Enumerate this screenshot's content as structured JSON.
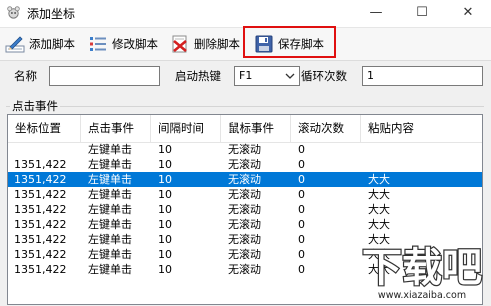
{
  "window": {
    "title": "添加坐标",
    "controls": {
      "minimize": "—",
      "maximize": "☐",
      "close": "✕"
    }
  },
  "toolbar": {
    "add_label": "添加脚本",
    "edit_label": "修改脚本",
    "delete_label": "删除脚本",
    "save_label": "保存脚本"
  },
  "form": {
    "name_label": "名称",
    "name_value": "",
    "hotkey_label": "启动热键",
    "hotkey_value": "F1",
    "loop_label": "循环次数",
    "loop_value": "1"
  },
  "events_group": {
    "title": "点击事件",
    "columns": [
      "坐标位置",
      "点击事件",
      "间隔时间",
      "鼠标事件",
      "滚动次数",
      "粘贴内容"
    ],
    "rows": [
      {
        "pos": "",
        "click": "左键单击",
        "interval": "10",
        "mouse": "无滚动",
        "scroll": "0",
        "paste": "",
        "selected": false
      },
      {
        "pos": "1351,422",
        "click": "左键单击",
        "interval": "10",
        "mouse": "无滚动",
        "scroll": "0",
        "paste": "",
        "selected": false
      },
      {
        "pos": "1351,422",
        "click": "左键单击",
        "interval": "10",
        "mouse": "无滚动",
        "scroll": "0",
        "paste": "大大",
        "selected": true
      },
      {
        "pos": "1351,422",
        "click": "左键单击",
        "interval": "10",
        "mouse": "无滚动",
        "scroll": "0",
        "paste": "大大",
        "selected": false
      },
      {
        "pos": "1351,422",
        "click": "左键单击",
        "interval": "10",
        "mouse": "无滚动",
        "scroll": "0",
        "paste": "大大",
        "selected": false
      },
      {
        "pos": "1351,422",
        "click": "左键单击",
        "interval": "10",
        "mouse": "无滚动",
        "scroll": "0",
        "paste": "大大",
        "selected": false
      },
      {
        "pos": "1351,422",
        "click": "左键单击",
        "interval": "10",
        "mouse": "无滚动",
        "scroll": "0",
        "paste": "大大",
        "selected": false
      },
      {
        "pos": "1351,422",
        "click": "左键单击",
        "interval": "10",
        "mouse": "无滚动",
        "scroll": "0",
        "paste": "大大",
        "selected": false
      },
      {
        "pos": "1351,422",
        "click": "左键单击",
        "interval": "10",
        "mouse": "无滚动",
        "scroll": "0",
        "paste": "大大",
        "selected": false
      }
    ]
  },
  "watermark": {
    "brand": "下载吧",
    "url": "www.xiazaiba.com"
  },
  "icons": {
    "app": "app-icon",
    "add": "edit-pencil-icon",
    "edit": "checklist-icon",
    "delete": "delete-x-icon",
    "save": "floppy-disk-icon",
    "dropdown": "chevron-down-icon"
  },
  "colors": {
    "selection": "#0078d7",
    "highlight_border": "#e01010"
  }
}
